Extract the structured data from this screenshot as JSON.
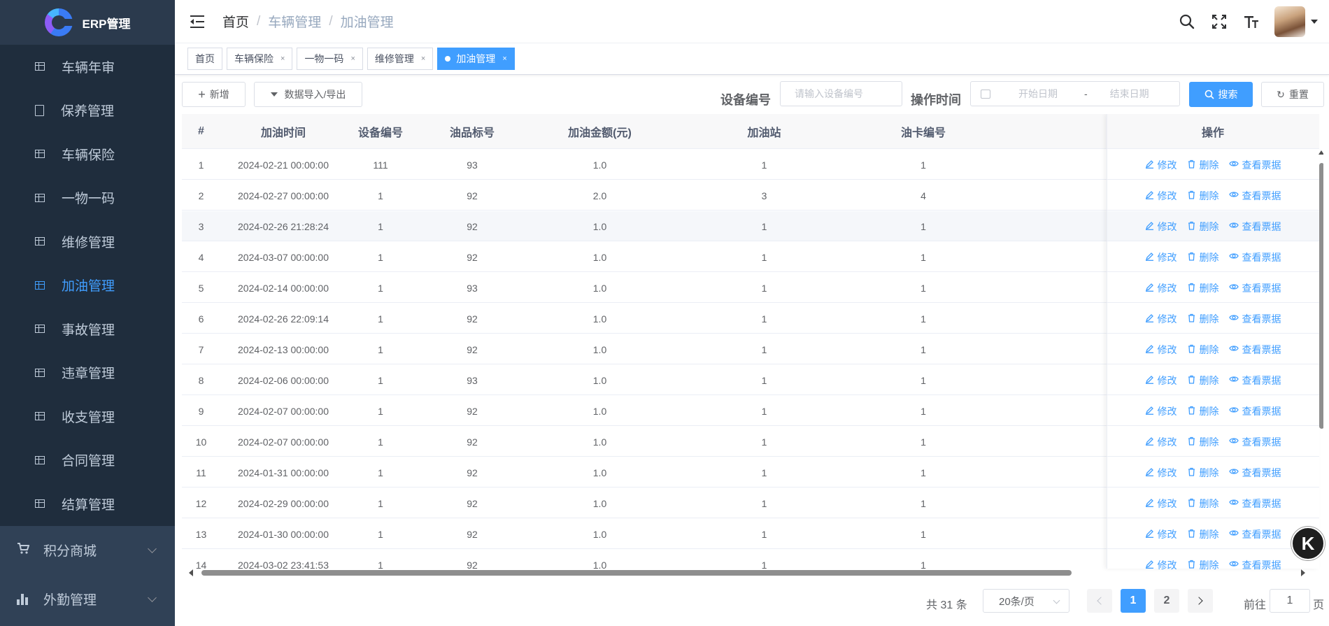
{
  "app": {
    "name": "ERP管理"
  },
  "sidebar": {
    "items": [
      {
        "label": "车辆年审",
        "icon": "table-icon",
        "active": false
      },
      {
        "label": "保养管理",
        "icon": "document-icon",
        "active": false
      },
      {
        "label": "车辆保险",
        "icon": "table-icon",
        "active": false
      },
      {
        "label": "一物一码",
        "icon": "table-icon",
        "active": false
      },
      {
        "label": "维修管理",
        "icon": "table-icon",
        "active": false
      },
      {
        "label": "加油管理",
        "icon": "table-icon",
        "active": true
      },
      {
        "label": "事故管理",
        "icon": "table-icon",
        "active": false
      },
      {
        "label": "违章管理",
        "icon": "table-icon",
        "active": false
      },
      {
        "label": "收支管理",
        "icon": "table-icon",
        "active": false
      },
      {
        "label": "合同管理",
        "icon": "table-icon",
        "active": false
      },
      {
        "label": "结算管理",
        "icon": "table-icon",
        "active": false
      }
    ],
    "groups": [
      {
        "label": "积分商城",
        "icon": "cart-icon"
      },
      {
        "label": "外勤管理",
        "icon": "bar-chart-icon"
      }
    ]
  },
  "navbar": {
    "breadcrumb": [
      "首页",
      "车辆管理",
      "加油管理"
    ],
    "separator": "/"
  },
  "tags": [
    {
      "label": "首页",
      "closable": false,
      "active": false
    },
    {
      "label": "车辆保险",
      "closable": true,
      "active": false
    },
    {
      "label": "一物一码",
      "closable": true,
      "active": false
    },
    {
      "label": "维修管理",
      "closable": true,
      "active": false
    },
    {
      "label": "加油管理",
      "closable": true,
      "active": true
    }
  ],
  "tag_close": "×",
  "toolbar": {
    "add_label": "新增",
    "import_export_label": "数据导入/导出",
    "device_label": "设备编号",
    "device_placeholder": "请输入设备编号",
    "time_label": "操作时间",
    "start_placeholder": "开始日期",
    "range_sep": "-",
    "end_placeholder": "结束日期",
    "search_label": "搜索",
    "reset_label": "重置"
  },
  "table": {
    "columns": [
      "#",
      "加油时间",
      "设备编号",
      "油品标号",
      "加油金额(元)",
      "加油站",
      "油卡编号",
      "操作"
    ],
    "actions": [
      "修改",
      "删除",
      "查看票据"
    ],
    "rows": [
      [
        "1",
        "2024-02-21 00:00:00",
        "111",
        "93",
        "1.0",
        "1",
        "1"
      ],
      [
        "2",
        "2024-02-27 00:00:00",
        "1",
        "92",
        "2.0",
        "3",
        "4"
      ],
      [
        "3",
        "2024-02-26 21:28:24",
        "1",
        "92",
        "1.0",
        "1",
        "1"
      ],
      [
        "4",
        "2024-03-07 00:00:00",
        "1",
        "92",
        "1.0",
        "1",
        "1"
      ],
      [
        "5",
        "2024-02-14 00:00:00",
        "1",
        "93",
        "1.0",
        "1",
        "1"
      ],
      [
        "6",
        "2024-02-26 22:09:14",
        "1",
        "92",
        "1.0",
        "1",
        "1"
      ],
      [
        "7",
        "2024-02-13 00:00:00",
        "1",
        "92",
        "1.0",
        "1",
        "1"
      ],
      [
        "8",
        "2024-02-06 00:00:00",
        "1",
        "93",
        "1.0",
        "1",
        "1"
      ],
      [
        "9",
        "2024-02-07 00:00:00",
        "1",
        "92",
        "1.0",
        "1",
        "1"
      ],
      [
        "10",
        "2024-02-07 00:00:00",
        "1",
        "92",
        "1.0",
        "1",
        "1"
      ],
      [
        "11",
        "2024-01-31 00:00:00",
        "1",
        "92",
        "1.0",
        "1",
        "1"
      ],
      [
        "12",
        "2024-02-29 00:00:00",
        "1",
        "92",
        "1.0",
        "1",
        "1"
      ],
      [
        "13",
        "2024-01-30 00:00:00",
        "1",
        "92",
        "1.0",
        "1",
        "1"
      ],
      [
        "14",
        "2024-03-02 23:41:53",
        "1",
        "92",
        "1.0",
        "1",
        "1"
      ]
    ],
    "highlighted_row": 2
  },
  "pagination": {
    "total_text": "共 31 条",
    "page_size": "20条/页",
    "pages": [
      "1",
      "2"
    ],
    "current_page": "1",
    "goto_label": "前往",
    "goto_value": "1",
    "page_suffix": "页"
  },
  "floating_badge": "K",
  "colors": {
    "sidebar_bg": "#304156",
    "menu_bg": "#1f2d3d",
    "accent": "#409eff",
    "menu_text": "#bfcbd9"
  }
}
